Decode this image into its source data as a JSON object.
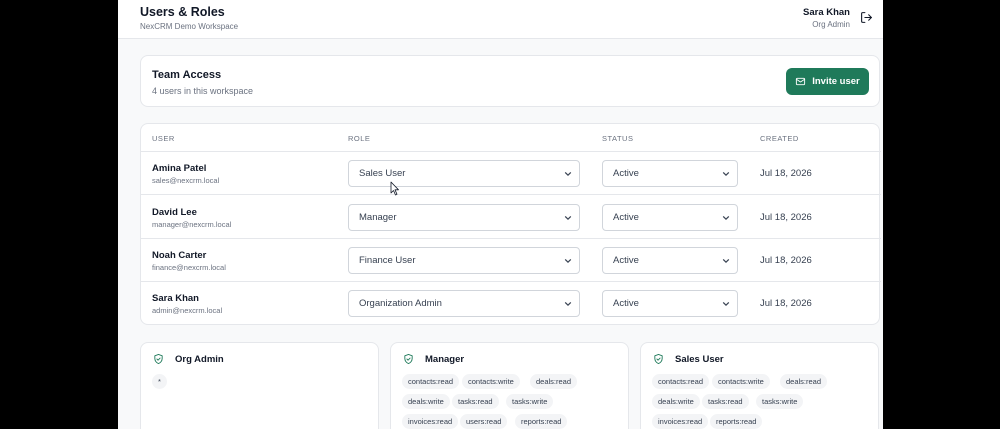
{
  "header": {
    "title": "Users & Roles",
    "subtitle": "NexCRM Demo Workspace",
    "user_name": "Sara Khan",
    "user_role": "Org Admin"
  },
  "team": {
    "title": "Team Access",
    "subtitle": "4 users in this workspace",
    "invite_label": "Invite user"
  },
  "table": {
    "headers": [
      "USER",
      "ROLE",
      "STATUS",
      "CREATED"
    ],
    "rows": [
      {
        "name": "Amina Patel",
        "email": "sales@nexcrm.local",
        "role": "Sales User",
        "status": "Active",
        "created": "Jul 18, 2026"
      },
      {
        "name": "David Lee",
        "email": "manager@nexcrm.local",
        "role": "Manager",
        "status": "Active",
        "created": "Jul 18, 2026"
      },
      {
        "name": "Noah Carter",
        "email": "finance@nexcrm.local",
        "role": "Finance User",
        "status": "Active",
        "created": "Jul 18, 2026"
      },
      {
        "name": "Sara Khan",
        "email": "admin@nexcrm.local",
        "role": "Organization Admin",
        "status": "Active",
        "created": "Jul 18, 2026"
      }
    ]
  },
  "roles": [
    {
      "title": "Org Admin",
      "permissions": [
        "*"
      ]
    },
    {
      "title": "Manager",
      "permissions": [
        "contacts:read",
        "contacts:write",
        "deals:read",
        "deals:write",
        "tasks:read",
        "tasks:write",
        "invoices:read",
        "users:read",
        "reports:read"
      ]
    },
    {
      "title": "Sales User",
      "permissions": [
        "contacts:read",
        "contacts:write",
        "deals:read",
        "deals:write",
        "tasks:read",
        "tasks:write",
        "invoices:read",
        "reports:read"
      ]
    }
  ],
  "colors": {
    "accent": "#1f7a5a",
    "background": "#f8f9fa"
  }
}
